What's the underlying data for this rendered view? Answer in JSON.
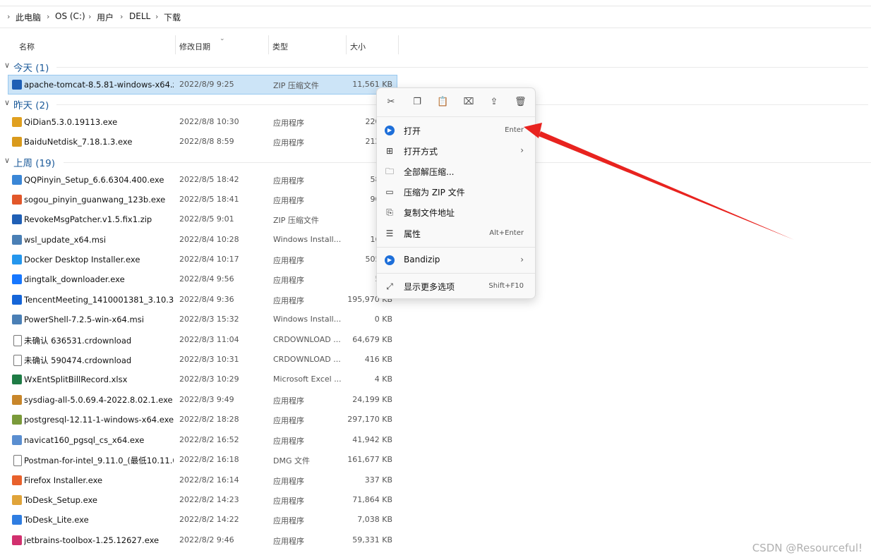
{
  "breadcrumb": [
    "此电脑",
    "OS (C:)",
    "用户",
    "DELL",
    "下载"
  ],
  "columns": {
    "name": "名称",
    "date": "修改日期",
    "type": "类型",
    "size": "大小"
  },
  "groups": [
    {
      "label": "今天 (1)"
    },
    {
      "label": "昨天 (2)"
    },
    {
      "label": "上周 (19)"
    }
  ],
  "files": [
    {
      "name": "apache-tomcat-8.5.81-windows-x64.zip",
      "date": "2022/8/9 9:25",
      "type": "ZIP 压缩文件",
      "size": "11,561 KB",
      "icon": "zip-icon",
      "color": "#1f5fb5"
    },
    {
      "name": "QiDian5.3.0.19113.exe",
      "date": "2022/8/8 10:30",
      "type": "应用程序",
      "size": "220,80",
      "icon": "qidian-icon",
      "color": "#e0a020"
    },
    {
      "name": "BaiduNetdisk_7.18.1.3.exe",
      "date": "2022/8/8 8:59",
      "type": "应用程序",
      "size": "212,25",
      "icon": "baidu-icon",
      "color": "#d99a1c"
    },
    {
      "name": "QQPinyin_Setup_6.6.6304.400.exe",
      "date": "2022/8/5 18:42",
      "type": "应用程序",
      "size": "58,28",
      "icon": "qqpinyin-icon",
      "color": "#3a86d6"
    },
    {
      "name": "sogou_pinyin_guanwang_123b.exe",
      "date": "2022/8/5 18:41",
      "type": "应用程序",
      "size": "90,96",
      "icon": "sogou-icon",
      "color": "#e2572a"
    },
    {
      "name": "RevokeMsgPatcher.v1.5.fix1.zip",
      "date": "2022/8/5 9:01",
      "type": "ZIP 压缩文件",
      "size": "5",
      "icon": "zip-icon",
      "color": "#1f5fb5"
    },
    {
      "name": "wsl_update_x64.msi",
      "date": "2022/8/4 10:28",
      "type": "Windows Install...",
      "size": "16,70",
      "icon": "msi-icon",
      "color": "#4a7fb5"
    },
    {
      "name": "Docker Desktop Installer.exe",
      "date": "2022/8/4 10:17",
      "type": "应用程序",
      "size": "505,63",
      "icon": "docker-icon",
      "color": "#2496ed"
    },
    {
      "name": "dingtalk_downloader.exe",
      "date": "2022/8/4 9:56",
      "type": "应用程序",
      "size": "5,09",
      "icon": "dingtalk-icon",
      "color": "#1677ff"
    },
    {
      "name": "TencentMeeting_1410001381_3.10.3.4...",
      "date": "2022/8/4 9:36",
      "type": "应用程序",
      "size": "195,970 KB",
      "icon": "tencentmeeting-icon",
      "color": "#1565d8"
    },
    {
      "name": "PowerShell-7.2.5-win-x64.msi",
      "date": "2022/8/3 15:32",
      "type": "Windows Install...",
      "size": "0 KB",
      "icon": "msi-icon",
      "color": "#4a7fb5"
    },
    {
      "name": "未确认 636531.crdownload",
      "date": "2022/8/3 11:04",
      "type": "CRDOWNLOAD ...",
      "size": "64,679 KB",
      "icon": "blank-file-icon",
      "color": "#ffffff"
    },
    {
      "name": "未确认 590474.crdownload",
      "date": "2022/8/3 10:31",
      "type": "CRDOWNLOAD ...",
      "size": "416 KB",
      "icon": "blank-file-icon",
      "color": "#ffffff"
    },
    {
      "name": "WxEntSplitBillRecord.xlsx",
      "date": "2022/8/3 10:29",
      "type": "Microsoft Excel ...",
      "size": "4 KB",
      "icon": "excel-icon",
      "color": "#1e7b45"
    },
    {
      "name": "sysdiag-all-5.0.69.4-2022.8.02.1.exe",
      "date": "2022/8/3 9:49",
      "type": "应用程序",
      "size": "24,199 KB",
      "icon": "sysdiag-icon",
      "color": "#c8862a"
    },
    {
      "name": "postgresql-12.11-1-windows-x64.exe",
      "date": "2022/8/2 18:28",
      "type": "应用程序",
      "size": "297,170 KB",
      "icon": "postgresql-icon",
      "color": "#7a9a3a"
    },
    {
      "name": "navicat160_pgsql_cs_x64.exe",
      "date": "2022/8/2 16:52",
      "type": "应用程序",
      "size": "41,942 KB",
      "icon": "navicat-icon",
      "color": "#5a8ed0"
    },
    {
      "name": "Postman-for-intel_9.11.0_(最低10.11.0...",
      "date": "2022/8/2 16:18",
      "type": "DMG 文件",
      "size": "161,677 KB",
      "icon": "blank-file-icon",
      "color": "#ffffff"
    },
    {
      "name": "Firefox Installer.exe",
      "date": "2022/8/2 16:14",
      "type": "应用程序",
      "size": "337 KB",
      "icon": "firefox-icon",
      "color": "#e8612c"
    },
    {
      "name": "ToDesk_Setup.exe",
      "date": "2022/8/2 14:23",
      "type": "应用程序",
      "size": "71,864 KB",
      "icon": "todesk-setup-icon",
      "color": "#e0a43a"
    },
    {
      "name": "ToDesk_Lite.exe",
      "date": "2022/8/2 14:22",
      "type": "应用程序",
      "size": "7,038 KB",
      "icon": "todesk-lite-icon",
      "color": "#2f7de1"
    },
    {
      "name": "jetbrains-toolbox-1.25.12627.exe",
      "date": "2022/8/2 9:46",
      "type": "应用程序",
      "size": "59,331 KB",
      "icon": "jetbrains-icon",
      "color": "#d1306e"
    }
  ],
  "context_menu": {
    "toolbar": [
      "cut-icon",
      "copy-icon",
      "paste-icon",
      "rename-icon",
      "share-icon",
      "delete-icon"
    ],
    "items": [
      {
        "label": "打开",
        "shortcut": "Enter",
        "icon": "open-icon"
      },
      {
        "label": "打开方式",
        "shortcut": "",
        "icon": "open-with-icon"
      },
      {
        "label": "全部解压缩...",
        "shortcut": "",
        "icon": "extract-all-icon"
      },
      {
        "label": "压缩为 ZIP 文件",
        "shortcut": "",
        "icon": "compress-zip-icon"
      },
      {
        "label": "复制文件地址",
        "shortcut": "",
        "icon": "copy-path-icon"
      },
      {
        "label": "属性",
        "shortcut": "Alt+Enter",
        "icon": "properties-icon"
      },
      {
        "label": "Bandizip",
        "shortcut": "",
        "icon": "bandizip-icon"
      },
      {
        "label": "显示更多选项",
        "shortcut": "Shift+F10",
        "icon": "more-options-icon"
      }
    ]
  },
  "watermark": "CSDN @Resourceful!"
}
